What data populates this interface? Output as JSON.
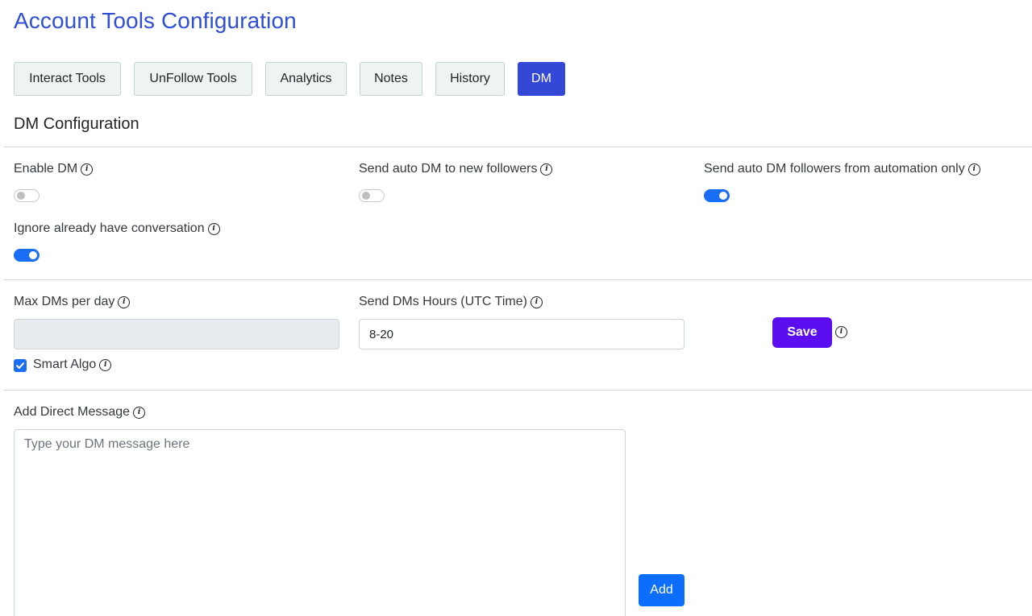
{
  "page_title": "Account Tools Configuration",
  "tabs": [
    {
      "label": "Interact Tools",
      "active": false
    },
    {
      "label": "UnFollow Tools",
      "active": false
    },
    {
      "label": "Analytics",
      "active": false
    },
    {
      "label": "Notes",
      "active": false
    },
    {
      "label": "History",
      "active": false
    },
    {
      "label": "DM",
      "active": true
    }
  ],
  "section_title": "DM Configuration",
  "info_glyph": "i",
  "toggles": {
    "enable_dm": {
      "label": "Enable DM",
      "on": false
    },
    "auto_dm_new_followers": {
      "label": "Send auto DM to new followers",
      "on": false
    },
    "auto_dm_automation_only": {
      "label": "Send auto DM followers from automation only",
      "on": true
    },
    "ignore_existing_conversation": {
      "label": "Ignore already have conversation",
      "on": true
    }
  },
  "limits": {
    "max_dms_label": "Max DMs per day",
    "max_dms_value": "",
    "hours_label": "Send DMs Hours (UTC Time)",
    "hours_value": "8-20",
    "smart_algo_label": "Smart Algo",
    "smart_algo_checked": true,
    "save_label": "Save"
  },
  "message": {
    "label": "Add Direct Message",
    "placeholder": "Type your DM message here",
    "value": "",
    "add_label": "Add"
  },
  "colors": {
    "title": "#2f4fd6",
    "active_tab": "#3448d8",
    "toggle_on": "#1a6ef5",
    "save_button": "#5b0ff0",
    "add_button": "#0d6efd"
  }
}
